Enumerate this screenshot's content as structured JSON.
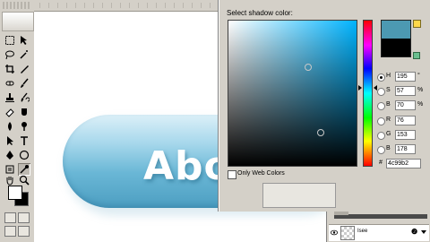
{
  "canvas": {
    "heading_text": "Abo"
  },
  "color_picker": {
    "title": "Select shadow color:",
    "only_web_colors_label": "Only Web Colors",
    "new_color": "#4c99b2",
    "current_color": "#000000",
    "fields": [
      {
        "key": "H",
        "value": "195",
        "unit": "°",
        "selected": true
      },
      {
        "key": "S",
        "value": "57",
        "unit": "%",
        "selected": false
      },
      {
        "key": "B",
        "value": "70",
        "unit": "%",
        "selected": false
      },
      {
        "key": "R",
        "value": "76",
        "unit": "",
        "selected": false
      },
      {
        "key": "G",
        "value": "153",
        "unit": "",
        "selected": false
      },
      {
        "key": "B",
        "value": "178",
        "unit": "",
        "selected": false
      }
    ],
    "hex_prefix": "#",
    "hex": "4c99b2"
  },
  "layers": {
    "layer_name": "Isee",
    "fx_label": "❷"
  },
  "tools": {
    "foreground_color": "#ffffff",
    "background_color": "#000000",
    "items": [
      "marquee",
      "move",
      "lasso",
      "magic-wand",
      "crop",
      "slice",
      "healing",
      "brush",
      "stamp",
      "history-brush",
      "eraser",
      "gradient",
      "blur",
      "dodge",
      "path-select",
      "type",
      "pen",
      "shape",
      "notes",
      "eyedropper",
      "hand",
      "zoom"
    ]
  }
}
